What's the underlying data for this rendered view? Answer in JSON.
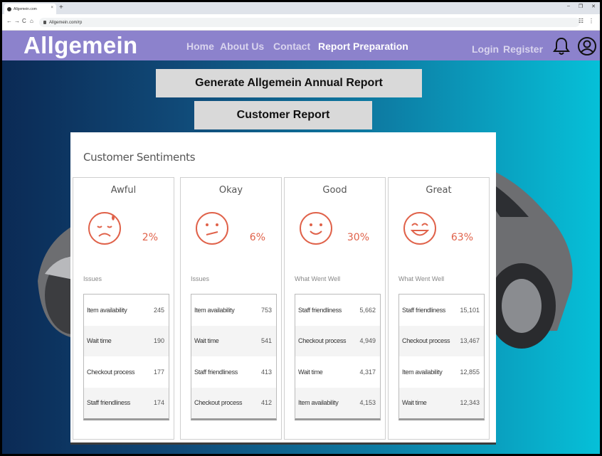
{
  "browser": {
    "tab_title": "Allgemein.com",
    "tab_close": "×",
    "new_tab": "+",
    "url": "Allgemein.com/rp",
    "nav_icons": [
      "←",
      "→",
      "C",
      "⌂"
    ],
    "window_controls": [
      "–",
      "❐",
      "✕"
    ],
    "toolbar_icons": [
      "☷",
      "⋮"
    ]
  },
  "site": {
    "logo": "Allgemein",
    "menu": [
      "Home",
      "About Us",
      "Contact",
      "Report Preparation"
    ],
    "login": "Login",
    "register": "Register"
  },
  "actions": {
    "annual_report": "Generate Allgemein Annual Report",
    "customer_report": "Customer Report"
  },
  "dashboard": {
    "title": "Customer Sentiments",
    "accent_color": "#e0624a",
    "cards": [
      {
        "title": "Awful",
        "pct": "2%",
        "subhead": "Issues",
        "face": "awful-face-icon",
        "rows": [
          {
            "label": "Item availability",
            "value": "245"
          },
          {
            "label": "Wait time",
            "value": "190"
          },
          {
            "label": "Checkout process",
            "value": "177"
          },
          {
            "label": "Staff friendliness",
            "value": "174"
          }
        ]
      },
      {
        "title": "Okay",
        "pct": "6%",
        "subhead": "Issues",
        "face": "okay-face-icon",
        "rows": [
          {
            "label": "Item availability",
            "value": "753"
          },
          {
            "label": "Wait time",
            "value": "541"
          },
          {
            "label": "Staff friendliness",
            "value": "413"
          },
          {
            "label": "Checkout process",
            "value": "412"
          }
        ]
      },
      {
        "title": "Good",
        "pct": "30%",
        "subhead": "What Went Well",
        "face": "good-face-icon",
        "rows": [
          {
            "label": "Staff friendliness",
            "value": "5,662"
          },
          {
            "label": "Checkout process",
            "value": "4,949"
          },
          {
            "label": "Wait time",
            "value": "4,317"
          },
          {
            "label": "Item availability",
            "value": "4,153"
          }
        ]
      },
      {
        "title": "Great",
        "pct": "63%",
        "subhead": "What Went Well",
        "face": "great-face-icon",
        "rows": [
          {
            "label": "Staff friendliness",
            "value": "15,101"
          },
          {
            "label": "Checkout process",
            "value": "13,467"
          },
          {
            "label": "Item availability",
            "value": "12,855"
          },
          {
            "label": "Wait time",
            "value": "12,343"
          }
        ]
      }
    ]
  }
}
